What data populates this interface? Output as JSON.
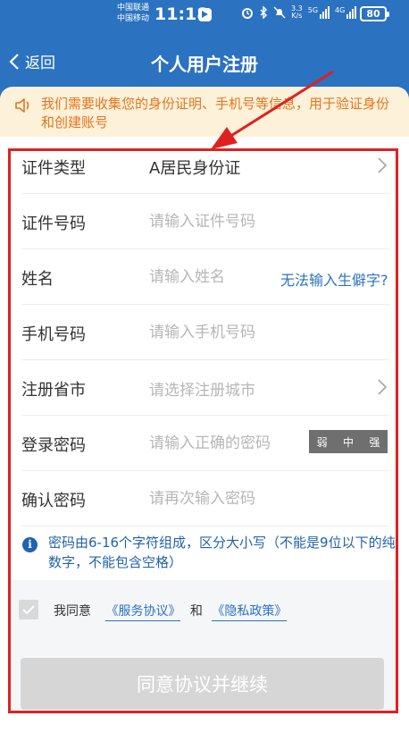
{
  "status_bar": {
    "carrier_1": "中国联通",
    "carrier_2": "中国移动",
    "time": "11:18",
    "net_speed_value": "3.3",
    "net_speed_unit": "K/s",
    "signal_1_tag": "5G",
    "signal_2_tag": "4G",
    "battery": "80"
  },
  "nav": {
    "back_label": "返回",
    "title": "个人用户注册"
  },
  "notice": {
    "text": "我们需要收集您的身份证明、手机号等信息，用于验证身份和创建账号",
    "accent_color": "#e2761e"
  },
  "form": {
    "id_type": {
      "label": "证件类型",
      "value": "A居民身份证"
    },
    "id_number": {
      "label": "证件号码",
      "placeholder": "请输入证件号码"
    },
    "name": {
      "label": "姓名",
      "placeholder": "请输入姓名",
      "link": "无法输入生僻字?"
    },
    "phone": {
      "label": "手机号码",
      "placeholder": "请输入手机号码"
    },
    "region": {
      "label": "注册省市",
      "placeholder": "请选择注册城市"
    },
    "password": {
      "label": "登录密码",
      "placeholder": "请输入正确的密码",
      "strength": [
        "弱",
        "中",
        "强"
      ]
    },
    "confirm_password": {
      "label": "确认密码",
      "placeholder": "请再次输入密码"
    },
    "password_hint": "密码由6-16个字符组成，区分大小写（不能是9位以下的纯数字，不能包含空格）"
  },
  "agreement": {
    "prefix": "我同意",
    "service_link": "《服务协议》",
    "conjunction": "和",
    "privacy_link": "《隐私政策》",
    "checked": false
  },
  "submit": {
    "label": "同意协议并继续",
    "enabled": false
  },
  "colors": {
    "header": "#2b72c0",
    "highlight_border": "#e02020",
    "link": "#2b72c0"
  }
}
